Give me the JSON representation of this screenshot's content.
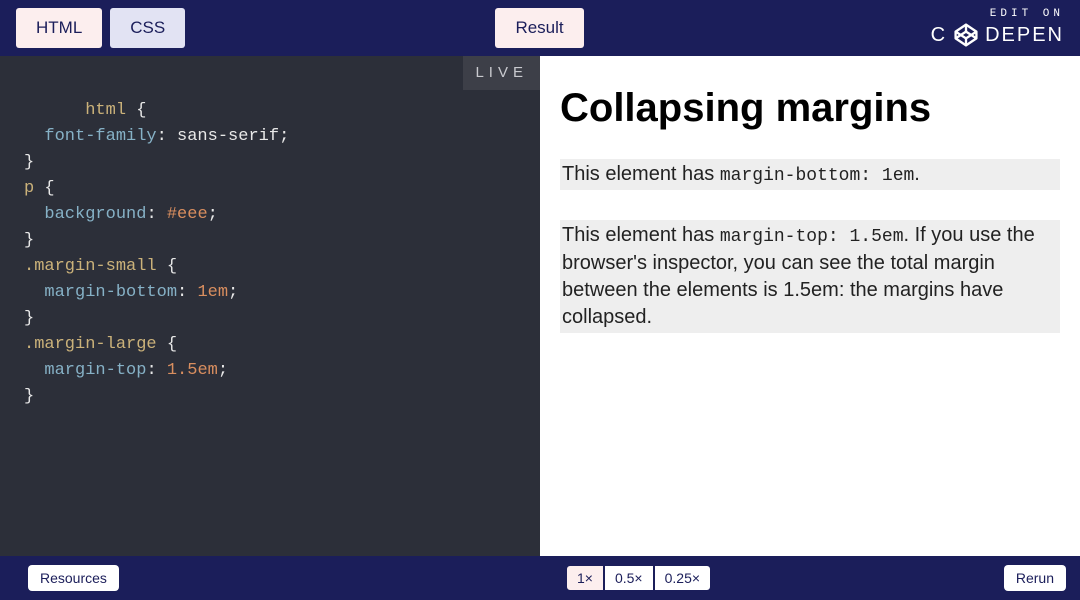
{
  "header": {
    "tabs": {
      "html": "HTML",
      "css": "CSS",
      "result": "Result"
    },
    "edit_on": "EDIT ON",
    "brand": "CODEPEN"
  },
  "editor": {
    "live_badge": "LIVE",
    "code": {
      "l1_sel": "html",
      "l1_b": " {",
      "l2_prop": "font-family",
      "l2_c": ": ",
      "l2_val": "sans-serif",
      "l2_e": ";",
      "l3": "}",
      "l4_sel": "p",
      "l4_b": " {",
      "l5_prop": "background",
      "l5_c": ": ",
      "l5_val": "#eee",
      "l5_e": ";",
      "l6": "}",
      "l7_sel": ".margin-small",
      "l7_b": " {",
      "l8_prop": "margin-bottom",
      "l8_c": ": ",
      "l8_val": "1em",
      "l8_e": ";",
      "l9": "}",
      "l10_sel": ".margin-large",
      "l10_b": " {",
      "l11_prop": "margin-top",
      "l11_c": ": ",
      "l11_val": "1.5em",
      "l11_e": ";",
      "l12": "}"
    }
  },
  "result": {
    "heading": "Collapsing margins",
    "p1_a": "This element has ",
    "p1_code": "margin-bottom: 1em",
    "p1_b": ".",
    "p2_a": "This element has ",
    "p2_code": "margin-top: 1.5em",
    "p2_b": ". If you use the browser's inspector, you can see the total margin between the elements is 1.5em: the margins have collapsed."
  },
  "footer": {
    "resources": "Resources",
    "zoom": {
      "z1": "1×",
      "z05": "0.5×",
      "z025": "0.25×"
    },
    "rerun": "Rerun"
  }
}
